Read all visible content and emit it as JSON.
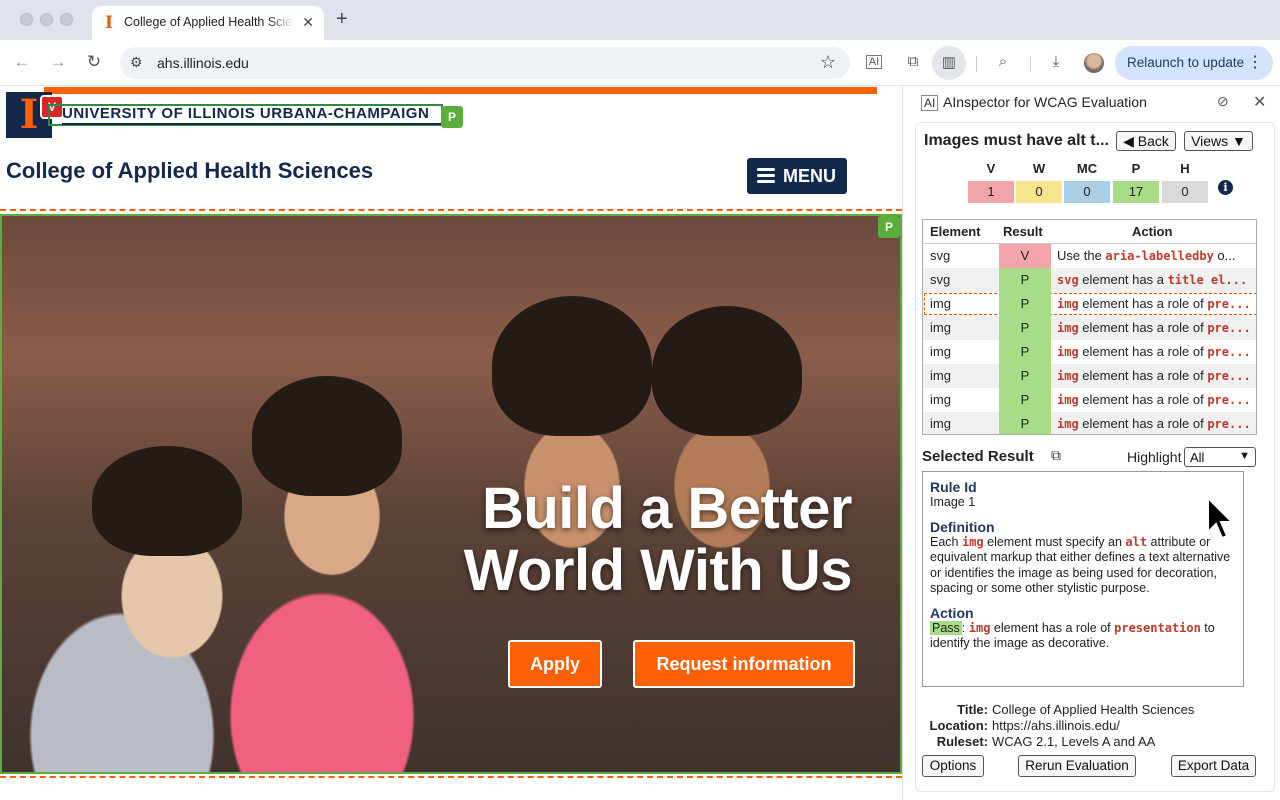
{
  "browser": {
    "tab_title": "College of Applied Health Sciences",
    "tab_favicon": "illinois-i-icon",
    "url": "ahs.illinois.edu",
    "relaunch_label": "Relaunch to update"
  },
  "site": {
    "university_name": "UNIVERSITY OF ILLINOIS URBANA-CHAMPAIGN",
    "logo_letter": "I",
    "college_title": "College of Applied Health Sciences",
    "menu_label": "MENU",
    "badge_violation": "V",
    "badge_pass": "P",
    "hero": {
      "headline_line1": "Build a Better",
      "headline_line2": "World With Us",
      "apply_label": "Apply",
      "request_label": "Request information"
    }
  },
  "panel": {
    "icon_label": "AI",
    "title": "AInspector for WCAG Evaluation",
    "rule_heading": "Images must have alt t...",
    "back_label": "◀ Back",
    "views_label": "Views ▼",
    "summary": {
      "labels": [
        "V",
        "W",
        "MC",
        "P",
        "H"
      ],
      "values": [
        "1",
        "0",
        "0",
        "17",
        "0"
      ],
      "colors": [
        "#f1a5ab",
        "#f6e58d",
        "#a9cfe6",
        "#a8dc86",
        "#d9d9d9"
      ]
    },
    "results_headers": {
      "element": "Element",
      "result": "Result",
      "action": "Action"
    },
    "results": [
      {
        "element": "svg",
        "result": "V",
        "action_pre": "Use the ",
        "action_code": "aria-labelledby",
        "action_post": " o..."
      },
      {
        "element": "svg",
        "result": "P",
        "action_pre": "",
        "action_code": "svg",
        "action_post": " element has a ",
        "action_code2": "title el..."
      },
      {
        "element": "img",
        "result": "P",
        "action_pre": "",
        "action_code": "img",
        "action_post": " element has a role of ",
        "action_code2": "pre..."
      },
      {
        "element": "img",
        "result": "P",
        "action_pre": "",
        "action_code": "img",
        "action_post": " element has a role of ",
        "action_code2": "pre..."
      },
      {
        "element": "img",
        "result": "P",
        "action_pre": "",
        "action_code": "img",
        "action_post": " element has a role of ",
        "action_code2": "pre..."
      },
      {
        "element": "img",
        "result": "P",
        "action_pre": "",
        "action_code": "img",
        "action_post": " element has a role of ",
        "action_code2": "pre..."
      },
      {
        "element": "img",
        "result": "P",
        "action_pre": "",
        "action_code": "img",
        "action_post": " element has a role of ",
        "action_code2": "pre..."
      },
      {
        "element": "img",
        "result": "P",
        "action_pre": "",
        "action_code": "img",
        "action_post": " element has a role of ",
        "action_code2": "pre..."
      }
    ],
    "selected_title": "Selected Result",
    "highlight_label": "Highlight",
    "highlight_value": "All",
    "detail": {
      "rule_id_heading": "Rule Id",
      "rule_id": "Image 1",
      "definition_heading": "Definition",
      "definition_1": "Each ",
      "definition_code1": "img",
      "definition_2": " element must specify an ",
      "definition_code2": "alt",
      "definition_3": " attribute or equivalent markup that either defines a text alternative or identifies the image as being used for decoration, spacing or some other stylistic purpose.",
      "action_heading": "Action",
      "action_pass": "Pass",
      "action_1": ": ",
      "action_code1": "img",
      "action_2": " element has a role of ",
      "action_code2": "presentation",
      "action_3": " to identify the image as decorative."
    },
    "meta": {
      "title_label": "Title:",
      "title_value": "College of Applied Health Sciences",
      "location_label": "Location:",
      "location_value": "https://ahs.illinois.edu/",
      "ruleset_label": "Ruleset:",
      "ruleset_value": "WCAG 2.1, Levels A and AA"
    },
    "buttons": {
      "options": "Options",
      "rerun": "Rerun Evaluation",
      "export": "Export Data"
    }
  }
}
